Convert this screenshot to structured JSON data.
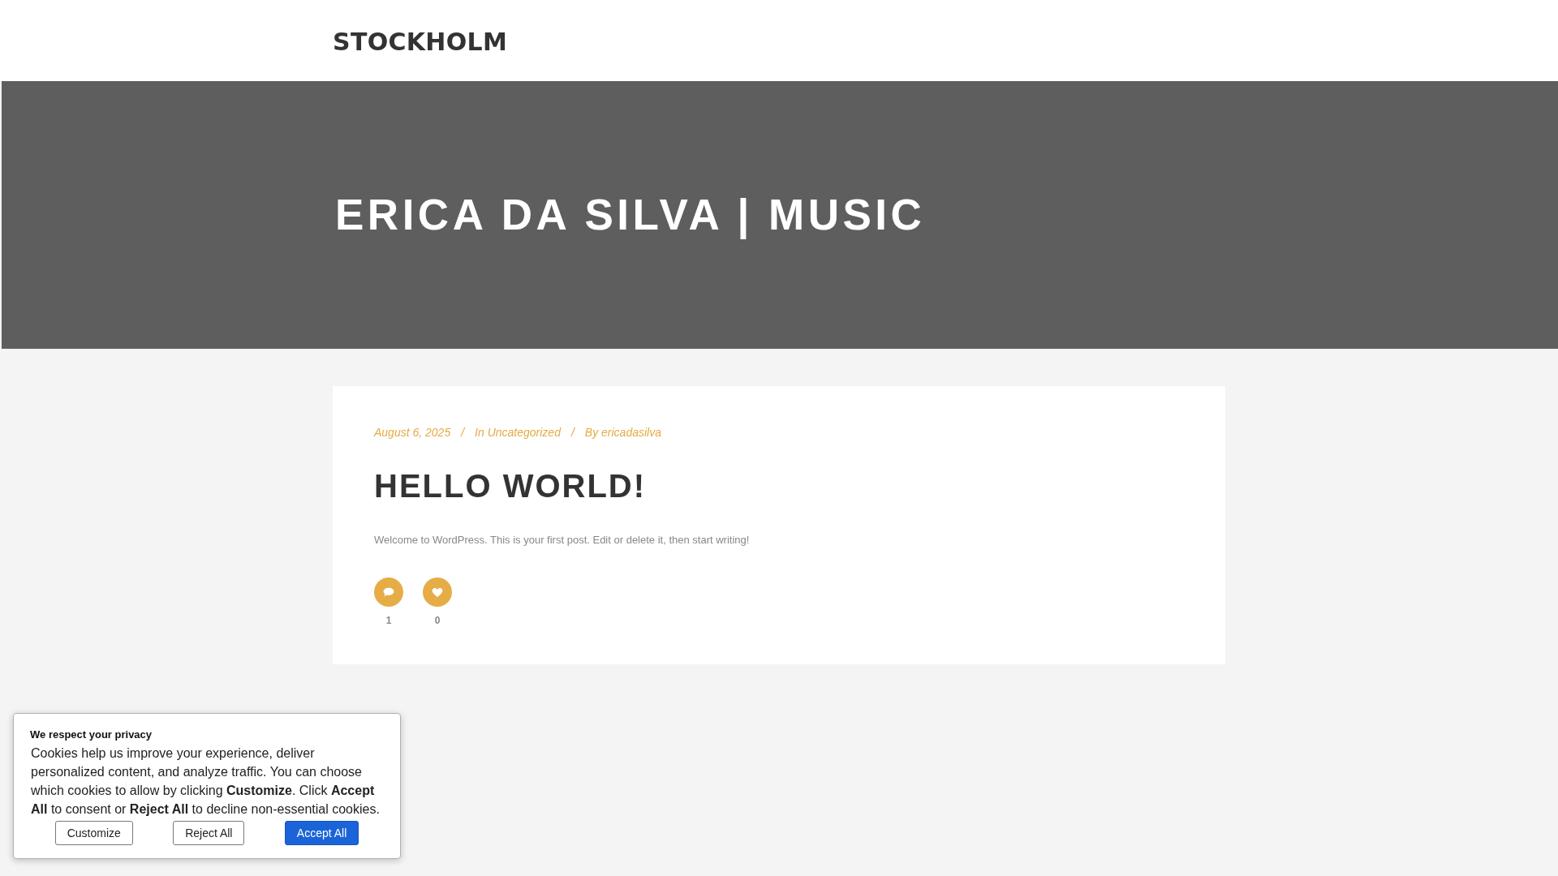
{
  "header": {
    "site_title": "STOCKHOLM"
  },
  "hero": {
    "title": "ERICA DA SILVA | MUSIC"
  },
  "post": {
    "meta": [
      {
        "kind": "date",
        "text": "August 6, 2025"
      },
      {
        "kind": "separator",
        "text": "/"
      },
      {
        "kind": "category",
        "text": "In Uncategorized"
      },
      {
        "kind": "separator",
        "text": "/"
      },
      {
        "kind": "author",
        "text": "By ericadasilva"
      }
    ],
    "title": "HELLO WORLD!",
    "excerpt": "Welcome to WordPress. This is your first post. Edit or delete it, then start writing!",
    "actions": [
      {
        "kind": "comment",
        "count": "1"
      },
      {
        "kind": "like",
        "count": "0"
      }
    ]
  },
  "cookie_banner": {
    "title": "We respect your privacy",
    "text": "Cookies help us improve your experience, deliver personalized content, and analyze traffic. You can choose which cookies to allow by clicking **Customize**. Click **Accept All** to consent or **Reject All** to decline non-essential cookies.",
    "buttons": [
      {
        "kind": "customize",
        "label": "Customize"
      },
      {
        "kind": "reject",
        "label": "Reject All"
      },
      {
        "kind": "accept",
        "label": "Accept All"
      }
    ]
  }
}
